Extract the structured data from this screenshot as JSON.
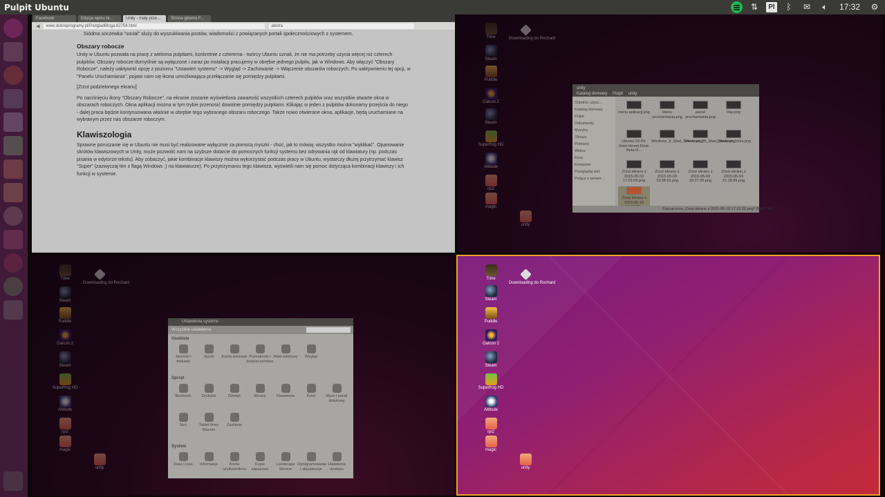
{
  "top_panel": {
    "title": "Pulpit Ubuntu",
    "keyboard_layout": "Pl",
    "clock": "17:32",
    "icons": [
      "spotify-icon",
      "network-icon",
      "keyboard-icon",
      "bluetooth-icon",
      "mail-icon",
      "volume-icon",
      "gear-icon"
    ]
  },
  "launcher": {
    "items": [
      "dash-icon",
      "files-icon",
      "browser-icon",
      "terminal-icon",
      "document-icon",
      "spreadsheet-icon",
      "presentation-icon",
      "font-icon",
      "settings-icon",
      "software-icon",
      "music-icon",
      "spotify-icon",
      "workspace-switcher-icon",
      "trash-icon"
    ]
  },
  "browser": {
    "tabs": [
      "Facebook",
      "Edycja wpisu bl...",
      "Unity - mały prze...",
      "Strona główna F..."
    ],
    "url": "www.dobreprogramy.pl/PodgladBloga,62756.html",
    "search": "abstra",
    "bullet": "Siódma soczewka \"social\" służy do wyszukiwania postów, wiadomości z powiązanych portali społecznościowych z systemem.",
    "h_workspaces": "Obszary robocze",
    "p1": "Unity w Ubuntu pozwala na pracę z wieloma pulpitami, konkretnie z czterema - twórcy Ubuntu uznali, że nie ma potrzeby użycia więcej niż czterech pulpitów. Obszary robocze domyślnie są wyłączone i zaraz po instalacji pracujemy w obrębie jednego pulpitu, jak w Windows. Aby włączyć \"Obszary Robocze\", należy uaktywnić opcję z poziomu \"Ustawień systemu\" -> Wygląd -> Zachowanie -> Włączenie obszarów roboczych. Po uaktywnieniu tej opcji, w \"Panelu Uruchamiania\", pojawi nam się ikona umożliwiająca przełączanie się pomiędzy pulpitami.",
    "p2": "[Zrzut podzielonego ekranu]",
    "p3": "Po naciśnięciu ikony \"Obszary Robocze\", na ekranie zostanie wyświetlona zawartość wszystkich czterech pulpitów oraz wszystkie otwarte okna w obszarach roboczych. Okna aplikacji można w tym trybie przenosić dowolnie pomiędzy pulpitami. Klikając w jeden z pulpitów dokonamy przejścia do niego - dalej praca będzie kontynuowana właśnie w obrębie tego wybranego obszaru roboczego. Także nowo otwierane okna, aplikacje, będą uruchamiane na wybranym przez nas obszarze roboczym.",
    "h_shortcuts": "Klawiszologia",
    "p4": "Sprawne poruszanie się w Ubuntu nie musi być realizowane wyłącznie za pomocą myszki - choć, jak to mówią: wszystko można \"wyklikać\". Opanowanie skrótów klawiszowych w Unity, może pozwolić nam na szybsze dotarcie do pomocnych funkcji systemu bez odrywania rąk od klawiatury (np. podczas pisania w edytorze tekstu). Aby zobaczyć, jakie kombinacje klawiszy można wykorzystać podczas pracy w Ubuntu, wystarczy dłużej przytrzymać klawisz \"Super\" (zazwyczaj ten z flagą Windows ;) na klawiaturze). Po przytrzymaniu tego klawisza, wyświetli nam się pomoc dotycząca kombinacji klawiszy i ich funkcji w systemie."
  },
  "desktop_icons": {
    "trine": "Trine",
    "rochard": "Downloading do Rochard",
    "steam": "Steam",
    "puddle": "Puddle",
    "galcon": "Galcon 2",
    "superfrog": "Superfrog HD",
    "altitude": "Altitude",
    "rpi2": "rpi2",
    "magic": "magic",
    "unity": "unity"
  },
  "file_manager": {
    "title": "unity",
    "path": [
      "Katalog domowy",
      "Pulpit",
      "unity"
    ],
    "sidebar": [
      "Ostatnio używ...",
      "Katalog domowy",
      "Pulpit",
      "Dokumenty",
      "Muzyka",
      "Obrazy",
      "Pobrane",
      "Wideo",
      "Kosz",
      "Komputer",
      "Przeglądaj sieć",
      "Połącz z serwer..."
    ],
    "files": [
      "menu aplikacji.png",
      "Menu uruchamiania.png",
      "panel uruchamiania.png",
      "tray.png",
      "Ubuntu-15-04-Vivid-Vervet-Final-Beta-O...",
      "Windows_8_Start_Screen.png",
      "Windows_95_Start_menu.png",
      "Windows_Vista.png",
      "Zrzut ekranu z 2015-05-03 17:01:06.png",
      "Zrzut ekranu z 2015-05-03 19:38:16.png",
      "Zrzut ekranu z 2015-05-03 20:27:26.png",
      "Zrzut ekranu z 2015-05-03 21:18:09.png",
      "Zrzut ekranu z 2015-05-10 17:12:22..."
    ],
    "status": "Zaznaczono „Zrzut ekranu z 2015-05-10 17:12:22.png\" (584,6 kB)"
  },
  "settings": {
    "title": "Ustawienia systemu",
    "toolbar_label": "Wszystkie ustawienia",
    "sections": [
      {
        "name": "Osobiste",
        "items": [
          "Jasność i blokada",
          "Języki",
          "Konta sieciowe",
          "Prywatność i bezpieczeństwo",
          "Wpis tekstowy",
          "Wygląd"
        ]
      },
      {
        "name": "Sprzęt",
        "items": [
          "Bluetooth",
          "Drukarki",
          "Dźwięk",
          "Ekrany",
          "Klawiatura",
          "Kolor",
          "Mysz i panel dotykowy",
          "Sieć",
          "Tablet firmy Wacom",
          "Zasilanie"
        ]
      },
      {
        "name": "System",
        "items": [
          "Data i czas",
          "Informacje",
          "Konta użytkowników",
          "Kopie zapasowe",
          "Landscape Service",
          "Oprogramowanie i aktualizacje",
          "Ułatwienia dostępu"
        ]
      }
    ]
  }
}
